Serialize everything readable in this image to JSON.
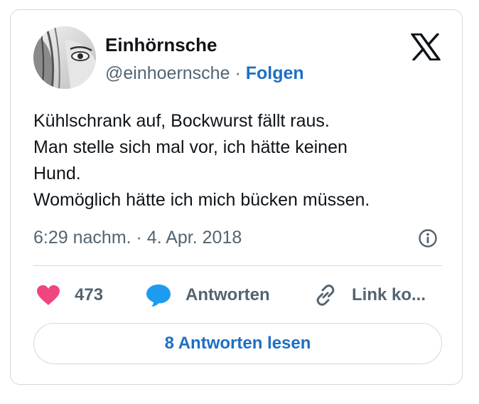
{
  "author": {
    "display_name": "Einhörnsche",
    "handle": "@einhoernsche",
    "separator": "·",
    "follow_label": "Folgen"
  },
  "tweet": {
    "lines": [
      "Kühlschrank auf, Bockwurst fällt raus.",
      "Man stelle sich mal vor, ich hätte keinen",
      "Hund.",
      "Womöglich hätte ich mich bücken müssen."
    ],
    "timestamp": "6:29 nachm. · 4. Apr. 2018"
  },
  "actions": {
    "like_count": "473",
    "reply_label": "Antworten",
    "link_label": "Link ko..."
  },
  "read_replies_label": "8 Antworten lesen",
  "icons": {
    "brand": "x-logo-icon",
    "info": "info-icon",
    "like": "heart-icon",
    "reply": "speech-bubble-icon",
    "link": "link-icon"
  },
  "colors": {
    "like": "#f0467e",
    "reply": "#1d9bf0",
    "link_text": "#1d6fc4",
    "secondary_text": "#536471",
    "border": "#cfd9de"
  }
}
